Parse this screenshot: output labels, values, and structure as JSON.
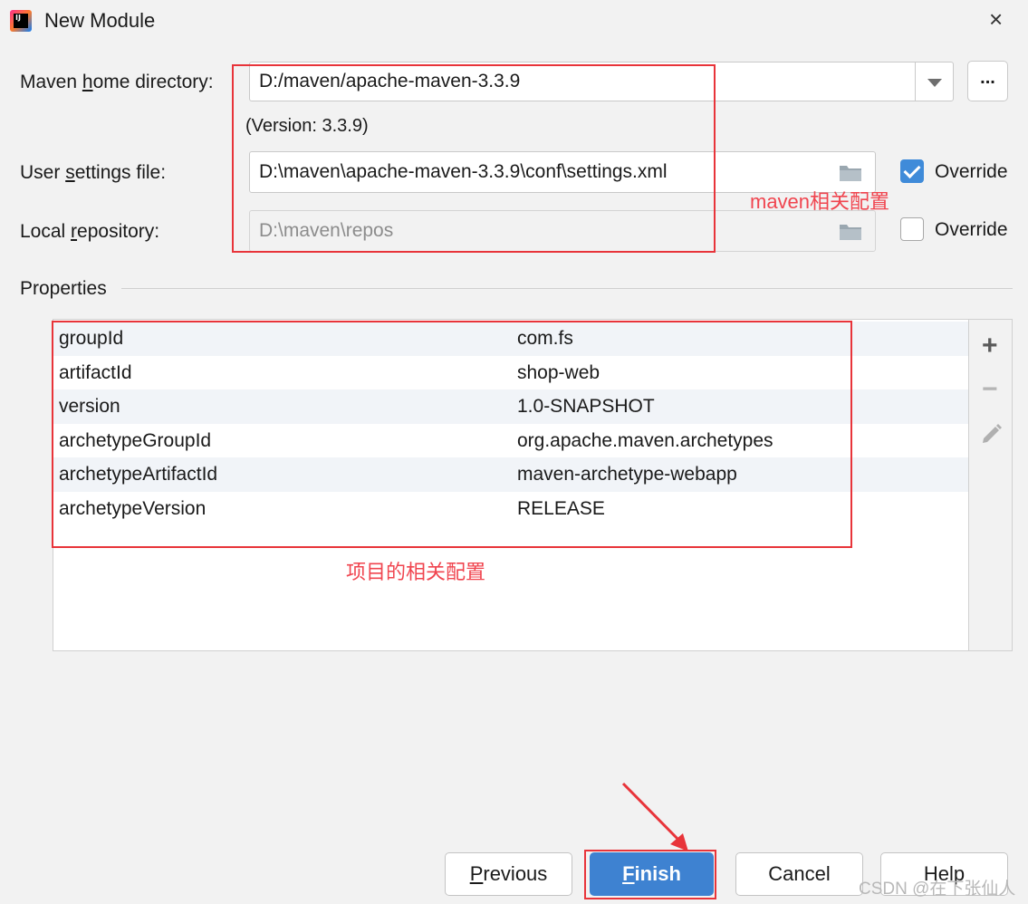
{
  "window": {
    "title": "New Module",
    "app_icon_text": "IJ",
    "close_glyph": "×"
  },
  "maven": {
    "home_label_pre": "Maven ",
    "home_label_mnemonic": "h",
    "home_label_post": "ome directory:",
    "home_value": "D:/maven/apache-maven-3.3.9",
    "browse_label": "...",
    "version_text": "(Version: 3.3.9)",
    "settings_label_pre": "User ",
    "settings_label_mnemonic": "s",
    "settings_label_post": "ettings file:",
    "settings_value": "D:\\maven\\apache-maven-3.3.9\\conf\\settings.xml",
    "settings_override_label": "Override",
    "settings_override_checked": true,
    "repo_label_pre": "Local ",
    "repo_label_mnemonic": "r",
    "repo_label_post": "epository:",
    "repo_value": "D:\\maven\\repos",
    "repo_override_label": "Override",
    "repo_override_checked": false
  },
  "annotations": {
    "maven_note": "maven相关配置",
    "project_note": "项目的相关配置",
    "accent_color": "#e8343a"
  },
  "properties": {
    "section_label": "Properties",
    "rows": [
      {
        "key": "groupId",
        "value": "com.fs"
      },
      {
        "key": "artifactId",
        "value": "shop-web"
      },
      {
        "key": "version",
        "value": "1.0-SNAPSHOT"
      },
      {
        "key": "archetypeGroupId",
        "value": "org.apache.maven.archetypes"
      },
      {
        "key": "archetypeArtifactId",
        "value": "maven-archetype-webapp"
      },
      {
        "key": "archetypeVersion",
        "value": "RELEASE"
      }
    ],
    "tools": {
      "add": "+",
      "remove": "−",
      "edit_icon": "pencil-icon"
    }
  },
  "buttons": {
    "previous_mnemonic": "P",
    "previous_rest": "revious",
    "finish_mnemonic": "F",
    "finish_rest": "inish",
    "cancel": "Cancel",
    "help": "Help",
    "primary_color": "#3e82d1"
  },
  "watermark": "CSDN @在下张仙人"
}
